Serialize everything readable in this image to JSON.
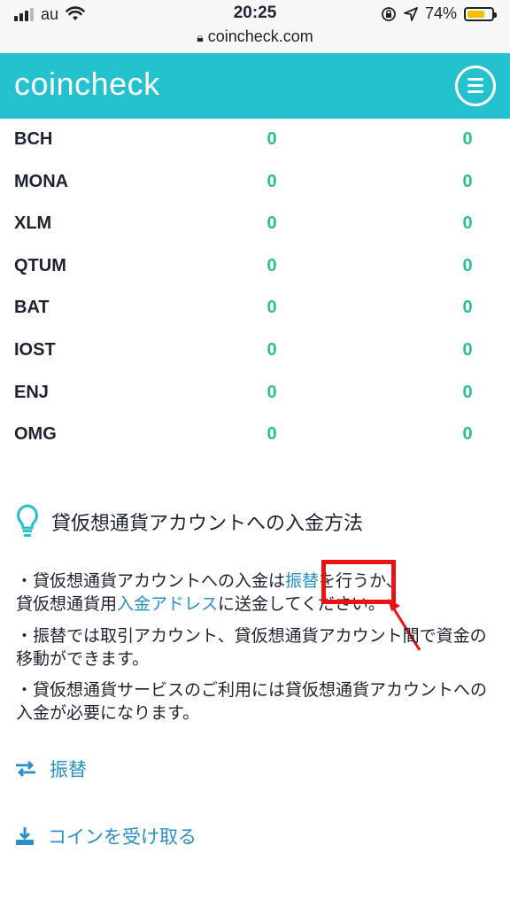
{
  "status_bar": {
    "carrier": "au",
    "time": "20:25",
    "battery": "74%",
    "url": "coincheck.com"
  },
  "header": {
    "logo": "coincheck"
  },
  "coins": [
    {
      "symbol": "BCH",
      "a": "0",
      "b": "0"
    },
    {
      "symbol": "MONA",
      "a": "0",
      "b": "0"
    },
    {
      "symbol": "XLM",
      "a": "0",
      "b": "0"
    },
    {
      "symbol": "QTUM",
      "a": "0",
      "b": "0"
    },
    {
      "symbol": "BAT",
      "a": "0",
      "b": "0"
    },
    {
      "symbol": "IOST",
      "a": "0",
      "b": "0"
    },
    {
      "symbol": "ENJ",
      "a": "0",
      "b": "0"
    },
    {
      "symbol": "OMG",
      "a": "0",
      "b": "0"
    }
  ],
  "section": {
    "title": "貸仮想通貨アカウントへの入金方法",
    "p1_a": "・貸仮想通貨アカウントへの入金は",
    "p1_link1": "振替",
    "p1_b": "を行うか、",
    "p1_c": "貸仮想通貨用",
    "p1_link2": "入金アドレス",
    "p1_d": "に送金してください。",
    "p2": "・振替では取引アカウント、貸仮想通貨アカウント間で資金の移動ができます。",
    "p3": "・貸仮想通貨サービスのご利用には貸仮想通貨アカウントへの入金が必要になります。"
  },
  "actions": {
    "transfer": "振替",
    "receive": "コインを受け取る"
  },
  "colors": {
    "brand": "#24c1cf",
    "value": "#2bbf93",
    "link": "#2a8fc7",
    "highlight": "#ee1111"
  }
}
